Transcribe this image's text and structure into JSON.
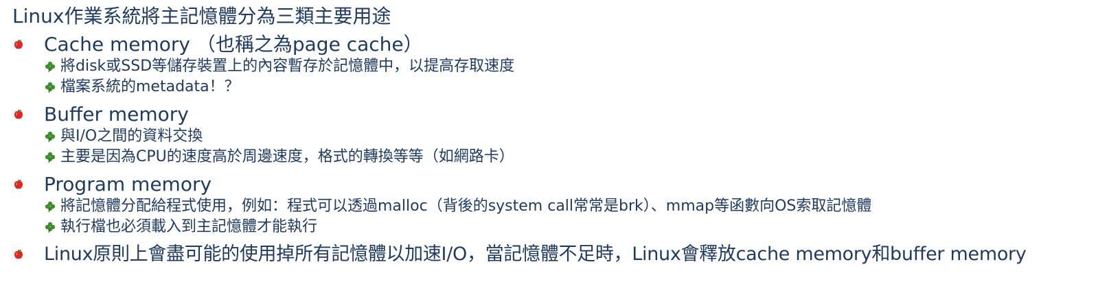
{
  "title": "Linux作業系統將主記憶體分為三類主要用途",
  "sections": [
    {
      "heading": "Cache memory （也稱之為page cache）",
      "items": [
        "將disk或SSD等儲存裝置上的內容暫存於記憶體中，以提高存取速度",
        "檔案系統的metadata！？"
      ]
    },
    {
      "heading": "Buffer memory",
      "items": [
        "與I/O之間的資料交換",
        "主要是因為CPU的速度高於周邊速度，格式的轉換等等（如網路卡）"
      ]
    },
    {
      "heading": "Program memory",
      "items": [
        "將記憶體分配給程式使用，例如：程式可以透過malloc（背後的system call常常是brk）、mmap等函數向OS索取記憶體",
        "執行檔也必須載入到主記憶體才能執行"
      ]
    },
    {
      "heading": "Linux原則上會盡可能的使用掉所有記憶體以加速I/O，當記憶體不足時，Linux會釋放cache memory和buffer memory",
      "items": []
    }
  ],
  "icons": {
    "bullet": "apple-icon",
    "sub_bullet": "clover-icon"
  },
  "colors": {
    "text": "#1f3a5f",
    "apple": "#d92b1f",
    "clover": "#3f8f2f"
  }
}
